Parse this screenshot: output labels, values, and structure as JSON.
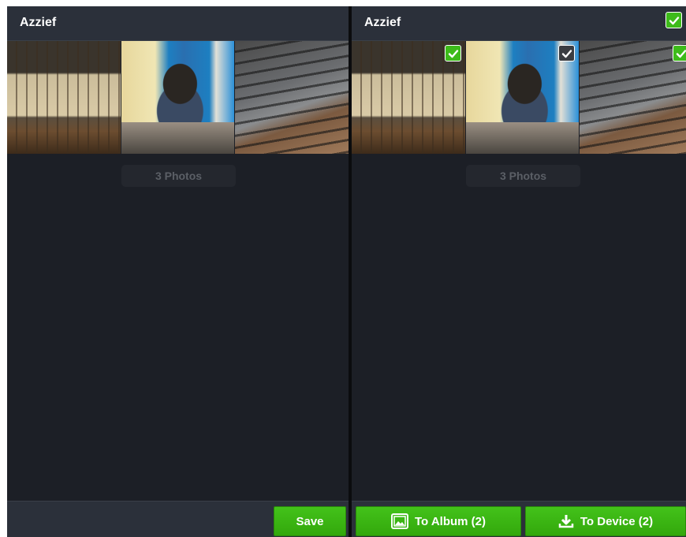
{
  "left_panel": {
    "album_title": "Azzief",
    "photo_count": "3 Photos",
    "save_label": "Save"
  },
  "right_panel": {
    "album_title": "Azzief",
    "photo_count": "3 Photos",
    "to_album_label": "To Album (2)",
    "to_device_label": "To Device (2)"
  },
  "thumbnails": [
    {
      "subject": "keyboard cream keys",
      "selected": true
    },
    {
      "subject": "person at desk",
      "selected": false
    },
    {
      "subject": "grey keyboard",
      "selected": true
    }
  ],
  "select_all_checked": true,
  "colors": {
    "background": "#1c1f26",
    "title_bar": "#2b303a",
    "accent_green": "#3dbb1a"
  },
  "icons": [
    "check-icon",
    "album-icon",
    "download-icon"
  ]
}
